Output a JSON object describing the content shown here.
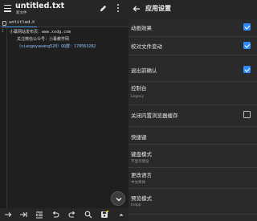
{
  "editor": {
    "title": "untitled.txt",
    "subtitle": "新文件",
    "tab_label": "untitled.",
    "tab_close": "×",
    "line_number": "1",
    "lines": [
      "小幕网站发布页：www.xxdg.com",
      "关注微信公众号：小幕教学网",
      "（xiaogeyawang520）QQ群：178563282"
    ]
  },
  "settings": {
    "title": "应用设置",
    "items": [
      {
        "label": "动画效果",
        "checked": true
      },
      {
        "label": "校对文件变动",
        "checked": true
      },
      {
        "label": "退出前确认",
        "checked": true
      },
      {
        "label": "控制台",
        "value": "Legacy"
      },
      {
        "label": "关闭内置浏览器缓存",
        "checked": false
      },
      {
        "label": "快捷键"
      },
      {
        "label": "键盘模式",
        "value": "不显示建议"
      },
      {
        "label": "更改语言",
        "value": "中文简体"
      },
      {
        "label": "预览模式",
        "value": "Inapp"
      }
    ]
  },
  "colors": {
    "accent": "#2f8bff",
    "background": "#2a2a2a",
    "editor_bg": "#1f1f1f"
  },
  "icons": {
    "menu": "menu-icon",
    "edit": "pencil-icon",
    "more": "more-vertical-icon",
    "back": "arrow-left-icon",
    "fab": "chevron-down-icon",
    "toolbar": [
      "redo-icon",
      "tab-indent-icon",
      "indent-icon",
      "undo-icon",
      "redo-icon",
      "search-icon",
      "save-icon",
      "caret-up-icon"
    ]
  }
}
